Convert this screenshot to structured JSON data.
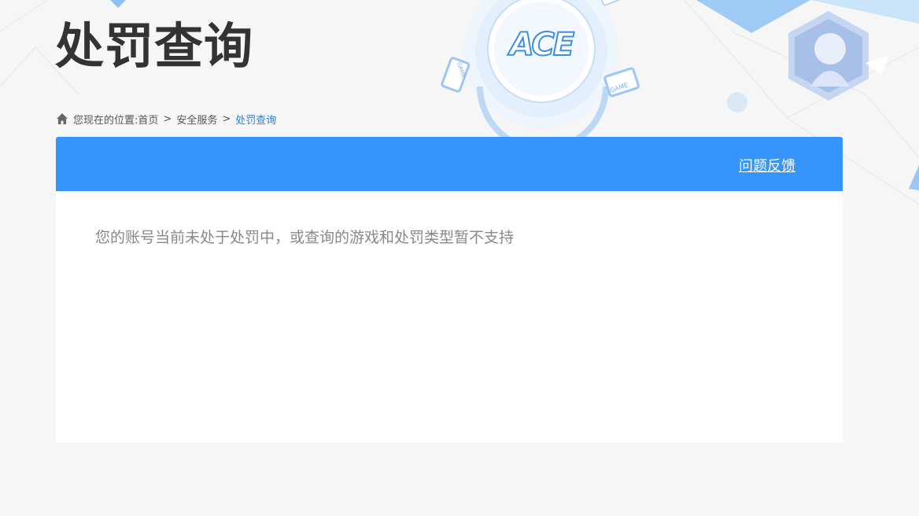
{
  "page": {
    "title": "处罚查询"
  },
  "header_logo": {
    "text": "ACE",
    "badge_text": "GAME"
  },
  "breadcrumb": {
    "prefix": "您现在的位置:",
    "items": [
      {
        "label": "首页"
      },
      {
        "label": "安全服务"
      },
      {
        "label": "处罚查询"
      }
    ],
    "separator": ">"
  },
  "panel": {
    "feedback_label": "问题反馈",
    "message": "您的账号当前未处于处罚中，或查询的游戏和处罚类型暂不支持"
  },
  "colors": {
    "accent": "#3595fc",
    "title": "#333333",
    "breadcrumb_current": "#2d7fd6"
  }
}
